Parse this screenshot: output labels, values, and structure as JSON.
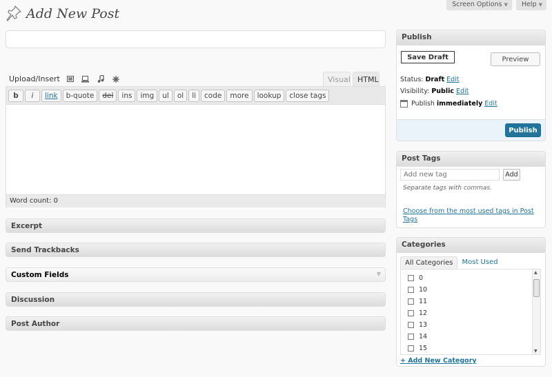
{
  "header": {
    "title": "Add New Post",
    "screen_options": "Screen Options",
    "help": "Help"
  },
  "post": {
    "title_value": ""
  },
  "upload": {
    "label": "Upload/Insert",
    "icons": [
      "image-icon",
      "video-icon",
      "audio-icon",
      "media-icon"
    ]
  },
  "editor": {
    "tab_visual": "Visual",
    "tab_html": "HTML",
    "quicktags": [
      "b",
      "i",
      "link",
      "b-quote",
      "del",
      "ins",
      "img",
      "ul",
      "ol",
      "li",
      "code",
      "more",
      "lookup",
      "close tags"
    ],
    "word_count": "Word count: 0"
  },
  "boxes": [
    "Excerpt",
    "Send Trackbacks",
    "Custom Fields",
    "Discussion",
    "Post Author"
  ],
  "publish": {
    "title": "Publish",
    "save_draft": "Save Draft",
    "preview": "Preview",
    "status_label": "Status:",
    "status_value": "Draft",
    "visibility_label": "Visibility:",
    "visibility_value": "Public",
    "publish_label": "Publish",
    "publish_value": "immediately",
    "edit": "Edit",
    "publish_button": "Publish"
  },
  "tags": {
    "title": "Post Tags",
    "placeholder": "Add new tag",
    "add": "Add",
    "hint": "Separate tags with commas.",
    "cloud_link": "Choose from the most used tags in Post Tags"
  },
  "categories": {
    "title": "Categories",
    "tab_all": "All Categories",
    "tab_most_used": "Most Used",
    "items": [
      "0",
      "10",
      "11",
      "12",
      "13",
      "14",
      "15"
    ],
    "add_new": "+ Add New Category"
  },
  "colors": {
    "accent": "#21759b",
    "publish_footer": "#eaf2fa"
  }
}
